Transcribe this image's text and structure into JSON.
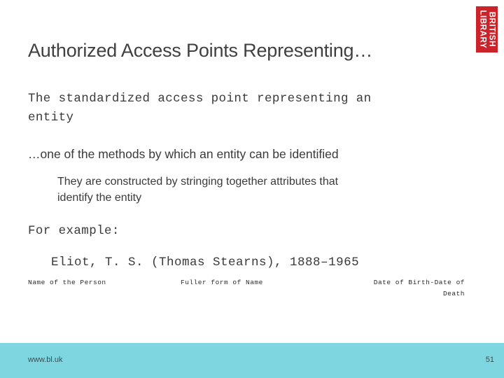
{
  "slide": {
    "title": "Authorized Access Points Representing…",
    "logo": {
      "line1": "BRITISH",
      "line2": "LIBRARY",
      "color": "#cc2229",
      "alt": "british-library-logo"
    },
    "body": {
      "definition_line1": "The standardized access point representing an",
      "definition_line2": "entity",
      "bullet1": "…one of the methods by which an entity can be identified",
      "bullet2_line1": "They are constructed by stringing together attributes that",
      "bullet2_line2": "identify the entity",
      "example_label": "For example:",
      "example_value": "Eliot, T. S. (Thomas Stearns), 1888–1965"
    },
    "annotations": [
      "Name of the Person",
      "Fuller form of Name",
      "Date of Birth-Date of\nDeath"
    ],
    "footer": {
      "url": "www.bl.uk",
      "page": "51",
      "background": "#7ed6e0"
    }
  }
}
